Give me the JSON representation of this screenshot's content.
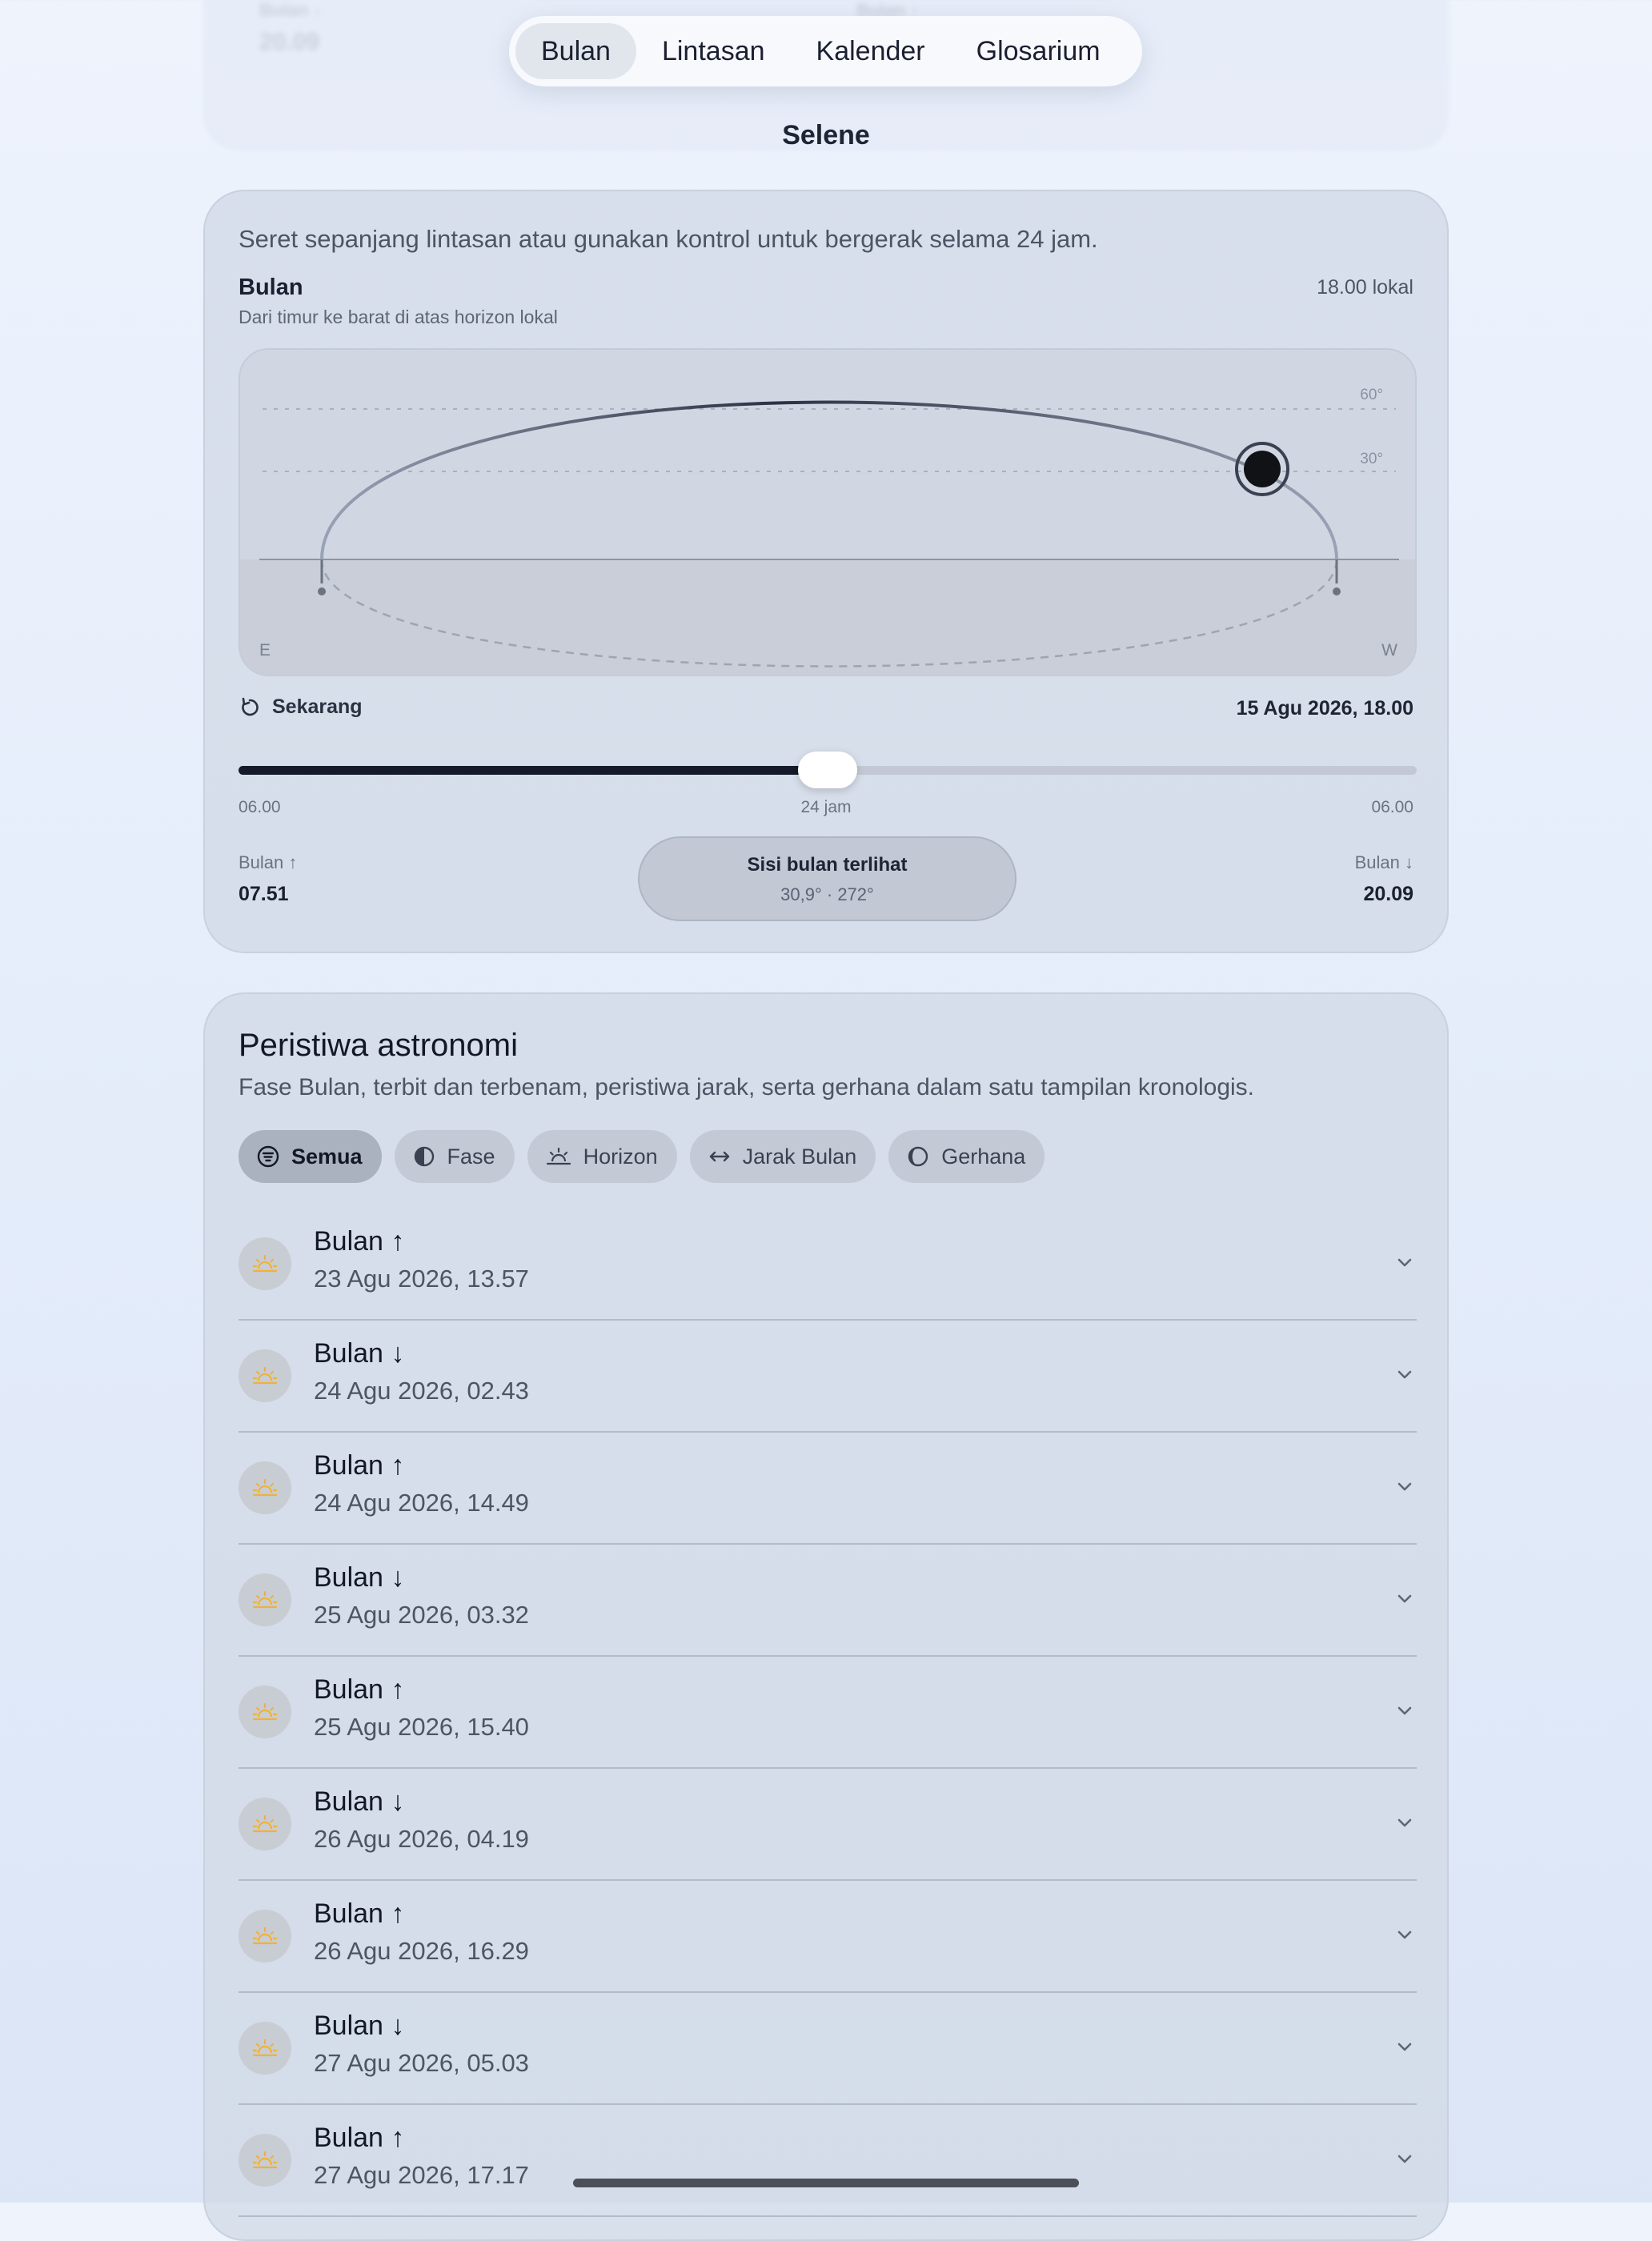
{
  "background_header": {
    "left_label": "Bulan ↓",
    "left_value": "20.09",
    "right_label": "Bulan ↑"
  },
  "nav": {
    "tabs": [
      {
        "label": "Bulan",
        "active": true
      },
      {
        "label": "Lintasan",
        "active": false
      },
      {
        "label": "Kalender",
        "active": false
      },
      {
        "label": "Glosarium",
        "active": false
      }
    ]
  },
  "app_title": "Selene",
  "sky_card": {
    "hint": "Seret sepanjang lintasan atau gunakan kontrol untuk bergerak selama 24 jam.",
    "title": "Bulan",
    "local_time": "18.00 lokal",
    "subtitle": "Dari timur ke barat di atas horizon lokal",
    "altitude_labels": [
      "60°",
      "30°"
    ],
    "dir_east": "E",
    "dir_west": "W",
    "reset_label": "Sekarang",
    "date_label": "15 Agu 2026, 18.00",
    "slider": {
      "value_fraction": 0.5,
      "tick_start": "06.00",
      "tick_mid": "24 jam",
      "tick_end": "06.00"
    },
    "rise": {
      "label": "Bulan ↑",
      "value": "07.51"
    },
    "set": {
      "label": "Bulan ↓",
      "value": "20.09"
    },
    "visible_side": {
      "title": "Sisi bulan terlihat",
      "value": "30,9° · 272°"
    }
  },
  "events_card": {
    "title": "Peristiwa astronomi",
    "subtitle": "Fase Bulan, terbit dan terbenam, peristiwa jarak, serta gerhana dalam satu tampilan kronologis.",
    "filters": [
      {
        "label": "Semua",
        "icon": "list-filter-icon",
        "active": true
      },
      {
        "label": "Fase",
        "icon": "half-moon-icon",
        "active": false
      },
      {
        "label": "Horizon",
        "icon": "sunrise-icon",
        "active": false
      },
      {
        "label": "Jarak Bulan",
        "icon": "arrows-horizontal-icon",
        "active": false
      },
      {
        "label": "Gerhana",
        "icon": "eclipse-icon",
        "active": false
      }
    ],
    "events": [
      {
        "name": "Bulan ↑",
        "when": "23 Agu 2026, 13.57"
      },
      {
        "name": "Bulan ↓",
        "when": "24 Agu 2026, 02.43"
      },
      {
        "name": "Bulan ↑",
        "when": "24 Agu 2026, 14.49"
      },
      {
        "name": "Bulan ↓",
        "when": "25 Agu 2026, 03.32"
      },
      {
        "name": "Bulan ↑",
        "when": "25 Agu 2026, 15.40"
      },
      {
        "name": "Bulan ↓",
        "when": "26 Agu 2026, 04.19"
      },
      {
        "name": "Bulan ↑",
        "when": "26 Agu 2026, 16.29"
      },
      {
        "name": "Bulan ↓",
        "when": "27 Agu 2026, 05.03"
      },
      {
        "name": "Bulan ↑",
        "when": "27 Agu 2026, 17.17"
      }
    ]
  },
  "colors": {
    "accent_dark": "#141a29",
    "horizon_icon": "#f0b13c"
  }
}
